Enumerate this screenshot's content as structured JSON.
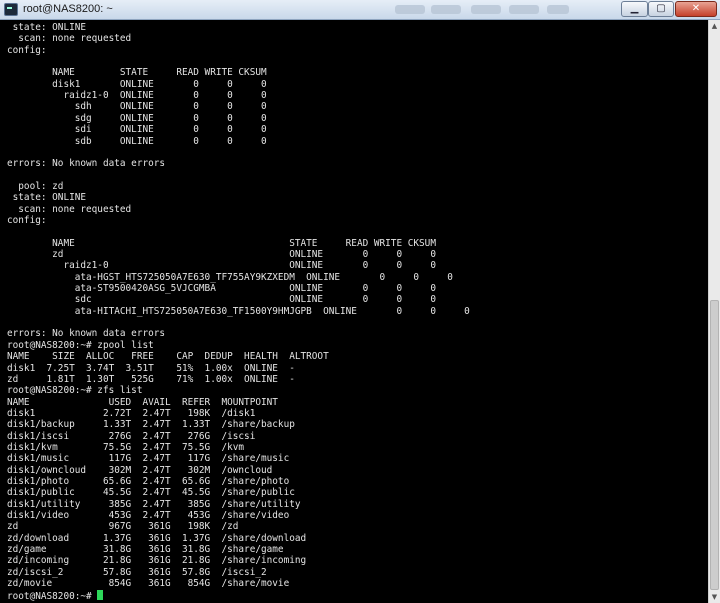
{
  "window": {
    "title": "root@NAS8200: ~",
    "buttons": {
      "minimize": "▁",
      "maximize": "▢",
      "close": "✕"
    }
  },
  "scrollbar": {
    "up_arrow": "▲",
    "down_arrow": "▼"
  },
  "colors": {
    "background": "#000000",
    "foreground": "#e4e4e4",
    "cursor": "#2dd85a"
  },
  "terminal": {
    "lines": [
      " state: ONLINE",
      "  scan: none requested",
      "config:",
      "",
      "        NAME        STATE     READ WRITE CKSUM",
      "        disk1       ONLINE       0     0     0",
      "          raidz1-0  ONLINE       0     0     0",
      "            sdh     ONLINE       0     0     0",
      "            sdg     ONLINE       0     0     0",
      "            sdi     ONLINE       0     0     0",
      "            sdb     ONLINE       0     0     0",
      "",
      "errors: No known data errors",
      "",
      "  pool: zd",
      " state: ONLINE",
      "  scan: none requested",
      "config:",
      "",
      "        NAME                                      STATE     READ WRITE CKSUM",
      "        zd                                        ONLINE       0     0     0",
      "          raidz1-0                                ONLINE       0     0     0",
      "            ata-HGST_HTS725050A7E630_TF755AY9KZXEDM  ONLINE       0     0     0",
      "            ata-ST9500420ASG_5VJCGMBA             ONLINE       0     0     0",
      "            sdc                                   ONLINE       0     0     0",
      "            ata-HITACHI_HTS725050A7E630_TF1500Y9HMJGPB  ONLINE       0     0     0",
      "",
      "errors: No known data errors",
      "root@NAS8200:~# zpool list",
      "NAME    SIZE  ALLOC   FREE    CAP  DEDUP  HEALTH  ALTROOT",
      "disk1  7.25T  3.74T  3.51T    51%  1.00x  ONLINE  -",
      "zd     1.81T  1.30T   525G    71%  1.00x  ONLINE  -",
      "root@NAS8200:~# zfs list",
      "NAME              USED  AVAIL  REFER  MOUNTPOINT",
      "disk1            2.72T  2.47T   198K  /disk1",
      "disk1/backup     1.33T  2.47T  1.33T  /share/backup",
      "disk1/iscsi       276G  2.47T   276G  /iscsi",
      "disk1/kvm        75.5G  2.47T  75.5G  /kvm",
      "disk1/music       117G  2.47T   117G  /share/music",
      "disk1/owncloud    302M  2.47T   302M  /owncloud",
      "disk1/photo      65.6G  2.47T  65.6G  /share/photo",
      "disk1/public     45.5G  2.47T  45.5G  /share/public",
      "disk1/utility     385G  2.47T   385G  /share/utility",
      "disk1/video       453G  2.47T   453G  /share/video",
      "zd                967G   361G   198K  /zd",
      "zd/download      1.37G   361G  1.37G  /share/download",
      "zd/game          31.8G   361G  31.8G  /share/game",
      "zd/incoming      21.8G   361G  21.8G  /share/incoming",
      "zd/iscsi_2       57.8G   361G  57.8G  /iscsi_2",
      "zd/movie          854G   361G   854G  /share/movie",
      "root@NAS8200:~# "
    ]
  }
}
